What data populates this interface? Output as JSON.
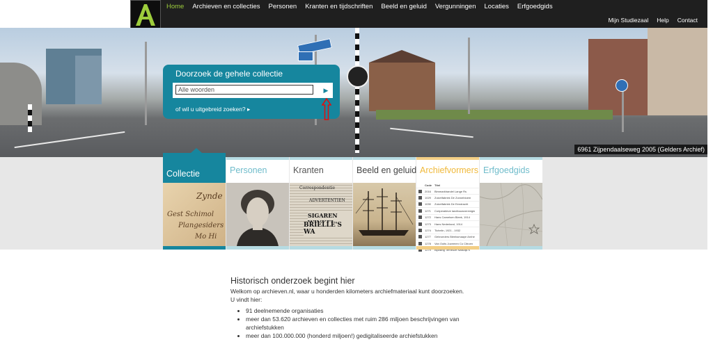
{
  "nav": {
    "logo_letter": "A",
    "main": [
      "Home",
      "Archieven en collecties",
      "Personen",
      "Kranten en tijdschriften",
      "Beeld en geluid",
      "Vergunningen",
      "Locaties",
      "Erfgoedgids"
    ],
    "active": "Home",
    "sub": [
      "Mijn Studiezaal",
      "Help",
      "Contact"
    ]
  },
  "hero": {
    "caption": "6961 Zijpendaalseweg 2005 (Gelders Archief)"
  },
  "search": {
    "title": "Doorzoek de gehele collectie",
    "placeholder": "Alle woorden",
    "submit": "▶",
    "advanced": "of wil u uitgebreid zoeken? ▸"
  },
  "tiles": [
    {
      "label": "Collectie",
      "color": "#ffffff",
      "active": true
    },
    {
      "label": "Personen",
      "color": "#6fbccb"
    },
    {
      "label": "Kranten",
      "color": "#555555"
    },
    {
      "label": "Beeld en geluid",
      "color": "#444444"
    },
    {
      "label": "Archiefvormers",
      "color": "#f0b93a"
    },
    {
      "label": "Erfgoedgids",
      "color": "#6fbccb"
    }
  ],
  "tile_images": {
    "collectie_script": [
      "Zynde",
      "Gest Schimol",
      "Plangesiders",
      "Mo Hi"
    ],
    "kranten_text": [
      "Correspondentie",
      "ADVERTENTIEN",
      "SIGAREN WINKEL",
      "BRIELLE'S WA"
    ],
    "archief_table": {
      "headers": [
        "Code",
        "Titel"
      ],
      "rows": [
        [
          "2016",
          "Bimmarkhandel Lange Rs"
        ],
        [
          "1029",
          "Zuivelfabriek De Zonnebloem"
        ],
        [
          "1030",
          "Zuivelfabriek De Eendracht"
        ],
        [
          "1271",
          "Coöperatieve landbouwvereniging"
        ],
        [
          "1272",
          "Hans Carnelsen Bleek, 1914"
        ],
        [
          "1273",
          "Hans Nederland, 1914"
        ],
        [
          "1274",
          "Tichelin, 1921 - 1932"
        ],
        [
          "1277",
          "Gebroeders Bleeksmaaye Arnhem"
        ],
        [
          "1278",
          "Van Ooits Jozeeren Co Citroen"
        ],
        [
          "1279",
          "Bijzaling Terneuze Nalsdijk K"
        ]
      ]
    }
  },
  "intro": {
    "heading": "Historisch onderzoek begint hier",
    "line1": "Welkom op archieven.nl, waar u honderden kilometers archiefmateriaal kunt doorzoeken.",
    "line2": "U vindt hier:",
    "bullets": [
      "91 deelnemende organisaties",
      "meer dan 53.620 archieven en collecties met ruim 286 miljoen beschrijvingen van archiefstukken",
      "meer dan 100.000.000 (honderd miljoen!) gedigitaliseerde archiefstukken"
    ]
  }
}
